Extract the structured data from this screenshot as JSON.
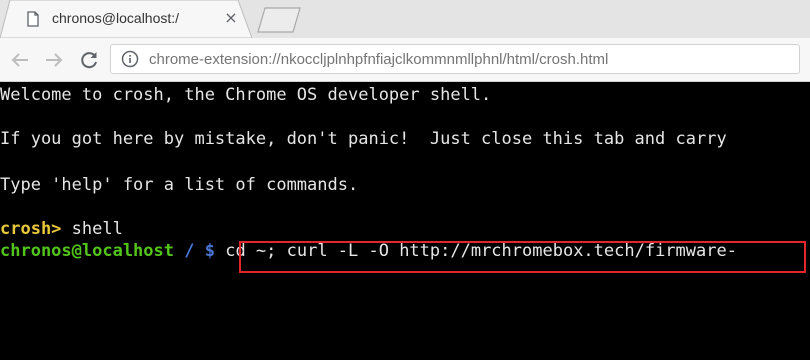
{
  "browser": {
    "tab": {
      "title": "chronos@localhost:/",
      "close_glyph": "×",
      "favicon_icon": "document-icon"
    },
    "toolbar": {
      "back_icon": "arrow-left-icon",
      "forward_icon": "arrow-right-icon",
      "reload_icon": "reload-icon",
      "site_info_icon": "info-icon",
      "url": "chrome-extension://nkoccljplnhpfnfiajclkommnmllphnl/html/crosh.html"
    }
  },
  "terminal": {
    "lines": [
      "Welcome to crosh, the Chrome OS developer shell.",
      "If you got here by mistake, don't panic!  Just close this tab and carry",
      "Type 'help' for a list of commands."
    ],
    "crosh_prompt": "crosh>",
    "crosh_command": " shell",
    "shell_user": "chronos@localhost",
    "shell_path": " / ",
    "shell_sign": "$",
    "shell_command": " cd ~; curl -L -O http://mrchromebox.tech/firmware-"
  },
  "colors": {
    "highlight_border": "#e3262c",
    "crosh_prompt": "#e9c83a",
    "shell_user": "#52c41a",
    "shell_path": "#4a78d8"
  }
}
